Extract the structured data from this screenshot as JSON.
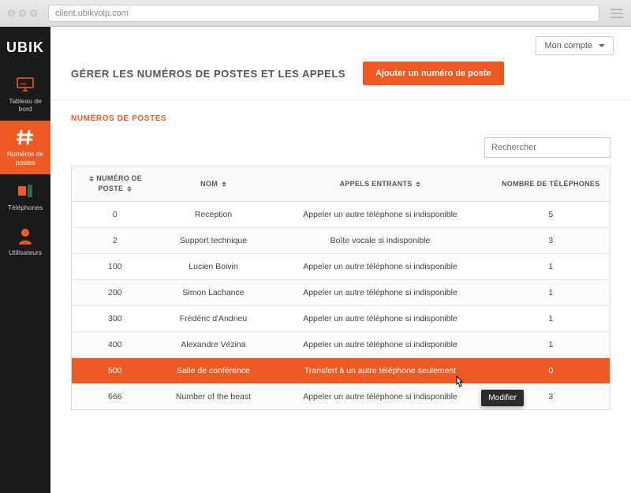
{
  "browser": {
    "url": "client.ubikvoip.com"
  },
  "brand": "UBIK",
  "account_menu": {
    "label": "Mon compte"
  },
  "sidebar": {
    "items": [
      {
        "label": "Tableau de bord"
      },
      {
        "label": "Numéros de postes"
      },
      {
        "label": "Téléphones"
      },
      {
        "label": "Utilisateurs"
      }
    ]
  },
  "page": {
    "title": "GÉRER LES NUMÉROS DE POSTES ET LES APPELS",
    "primary_button": "Ajouter un numéro de poste",
    "section_label": "NUMÉROS DE POSTES",
    "search_placeholder": "Rechercher",
    "modify_tip": "Modifier"
  },
  "table": {
    "headers": {
      "numero": "NUMÉRO DE POSTE",
      "nom": "NOM",
      "appels": "APPELS ENTRANTS",
      "tel": "NOMBRE DE TÉLÉPHONES"
    },
    "rows": [
      {
        "num": "0",
        "nom": "Reception",
        "calls": "Appeler un autre téléphone si indisponible",
        "tel": "5"
      },
      {
        "num": "2",
        "nom": "Support technique",
        "calls": "Boîte vocale si indisponible",
        "tel": "3"
      },
      {
        "num": "100",
        "nom": "Lucien Boivin",
        "calls": "Appeler un autre téléphone si indisponible",
        "tel": "1"
      },
      {
        "num": "200",
        "nom": "Simon Lachance",
        "calls": "Appeler un autre téléphone si indisponible",
        "tel": "1"
      },
      {
        "num": "300",
        "nom": "Frédéric d'Andrieu",
        "calls": "Appeler un autre téléphone si indisponible",
        "tel": "1"
      },
      {
        "num": "400",
        "nom": "Alexandre Vézina",
        "calls": "Appeler un autre téléphone si indisponible",
        "tel": "1"
      },
      {
        "num": "500",
        "nom": "Salle de conférence",
        "calls": "Transfert à un autre téléphone seulement",
        "tel": "0",
        "hovered": true
      },
      {
        "num": "666",
        "nom": "Number of the beast",
        "calls": "Appeler un autre téléphone si indisponible",
        "tel": "3"
      }
    ]
  }
}
